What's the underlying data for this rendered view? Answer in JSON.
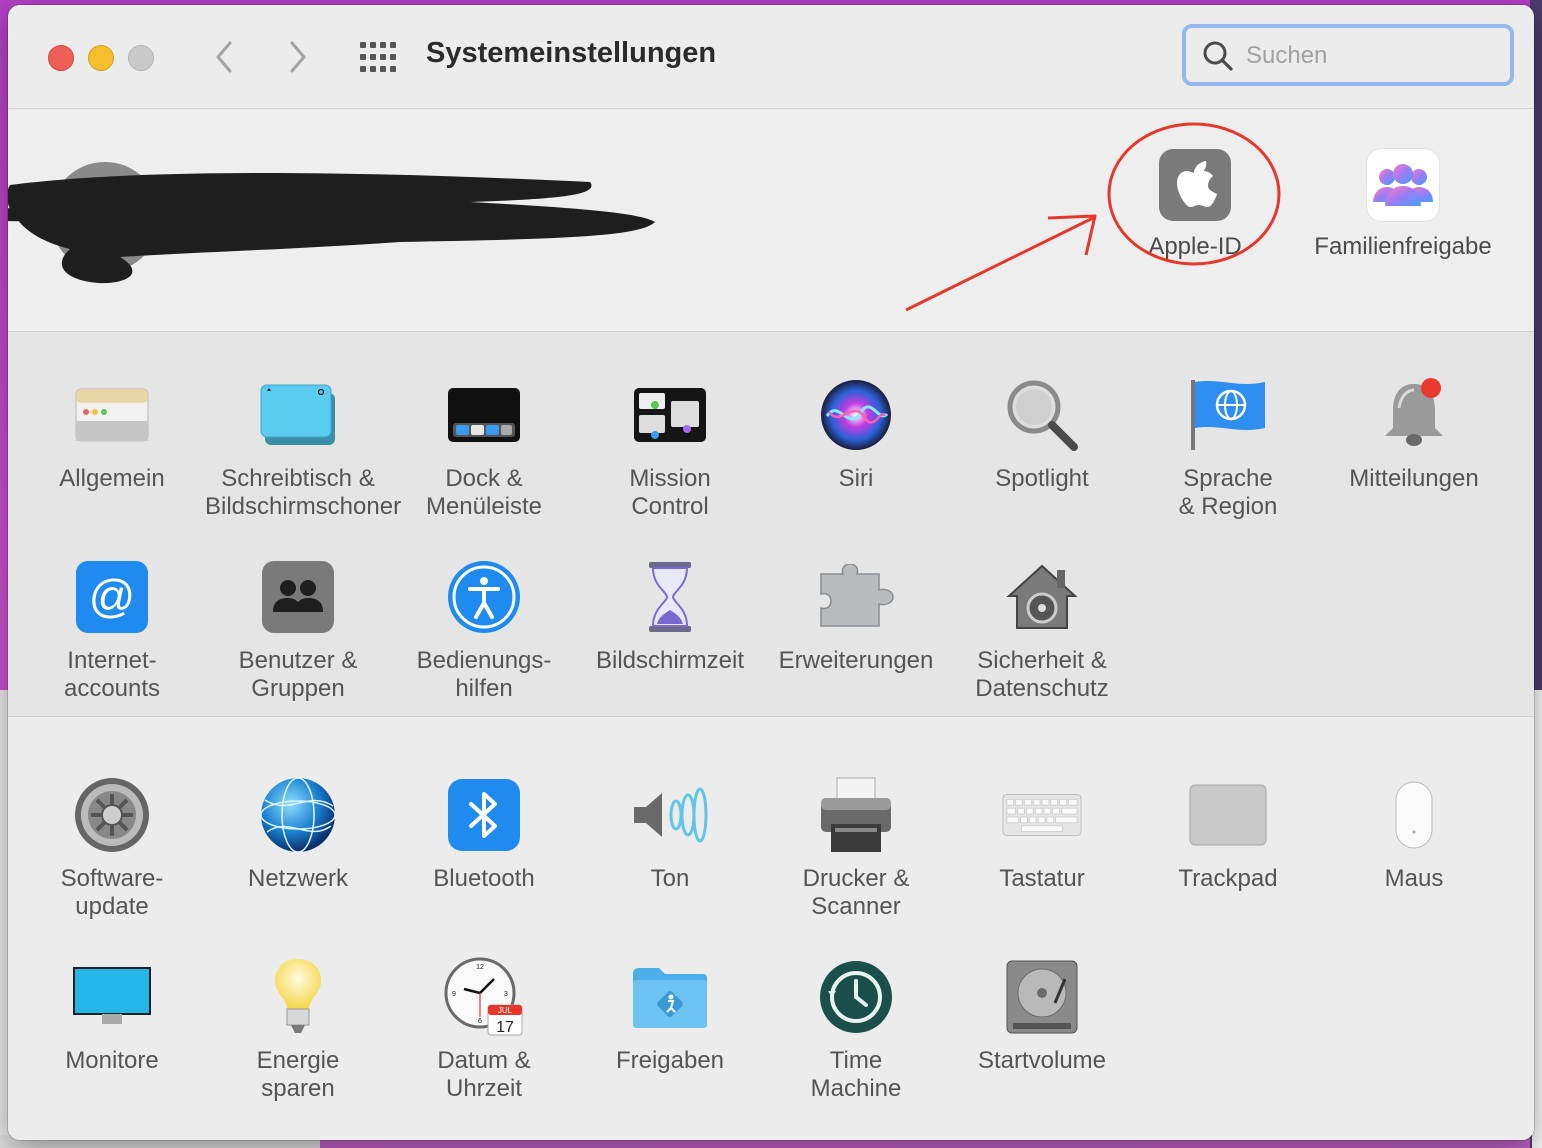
{
  "window": {
    "title": "Systemeinstellungen",
    "search_placeholder": "Suchen"
  },
  "account_row": {
    "apple_id_label": "Apple-ID",
    "family_label": "Familienfreigabe"
  },
  "section1": [
    {
      "label": "Allgemein",
      "icon": "general-icon"
    },
    {
      "label": "Schreibtisch &\nBildschirmschoner",
      "icon": "desktop-screensaver-icon"
    },
    {
      "label": "Dock &\nMenüleiste",
      "icon": "dock-icon"
    },
    {
      "label": "Mission\nControl",
      "icon": "mission-control-icon"
    },
    {
      "label": "Siri",
      "icon": "siri-icon"
    },
    {
      "label": "Spotlight",
      "icon": "spotlight-icon"
    },
    {
      "label": "Sprache\n& Region",
      "icon": "language-flag-icon"
    },
    {
      "label": "Mitteilungen",
      "icon": "notifications-bell-icon"
    },
    {
      "label": "Internet-\naccounts",
      "icon": "internet-accounts-icon"
    },
    {
      "label": "Benutzer &\nGruppen",
      "icon": "users-groups-icon"
    },
    {
      "label": "Bedienungs-\nhilfen",
      "icon": "accessibility-icon"
    },
    {
      "label": "Bildschirmzeit",
      "icon": "screen-time-icon"
    },
    {
      "label": "Erweiterungen",
      "icon": "extensions-icon"
    },
    {
      "label": "Sicherheit &\nDatenschutz",
      "icon": "security-icon"
    }
  ],
  "section2": [
    {
      "label": "Software-\nupdate",
      "icon": "software-update-icon"
    },
    {
      "label": "Netzwerk",
      "icon": "network-icon"
    },
    {
      "label": "Bluetooth",
      "icon": "bluetooth-icon"
    },
    {
      "label": "Ton",
      "icon": "sound-icon"
    },
    {
      "label": "Drucker &\nScanner",
      "icon": "printer-icon"
    },
    {
      "label": "Tastatur",
      "icon": "keyboard-icon"
    },
    {
      "label": "Trackpad",
      "icon": "trackpad-icon"
    },
    {
      "label": "Maus",
      "icon": "mouse-icon"
    },
    {
      "label": "Monitore",
      "icon": "monitor-icon"
    },
    {
      "label": "Energie\nsparen",
      "icon": "energy-bulb-icon"
    },
    {
      "label": "Datum &\nUhrzeit",
      "icon": "clock-calendar-icon"
    },
    {
      "label": "Freigaben",
      "icon": "sharing-folder-icon"
    },
    {
      "label": "Time\nMachine",
      "icon": "time-machine-icon"
    },
    {
      "label": "Startvolume",
      "icon": "startup-disk-icon"
    }
  ],
  "calendar_icon": {
    "month": "JUL",
    "day": "17"
  },
  "colors": {
    "annotation_red": "#e5382a",
    "search_ring": "#94b9ec"
  }
}
